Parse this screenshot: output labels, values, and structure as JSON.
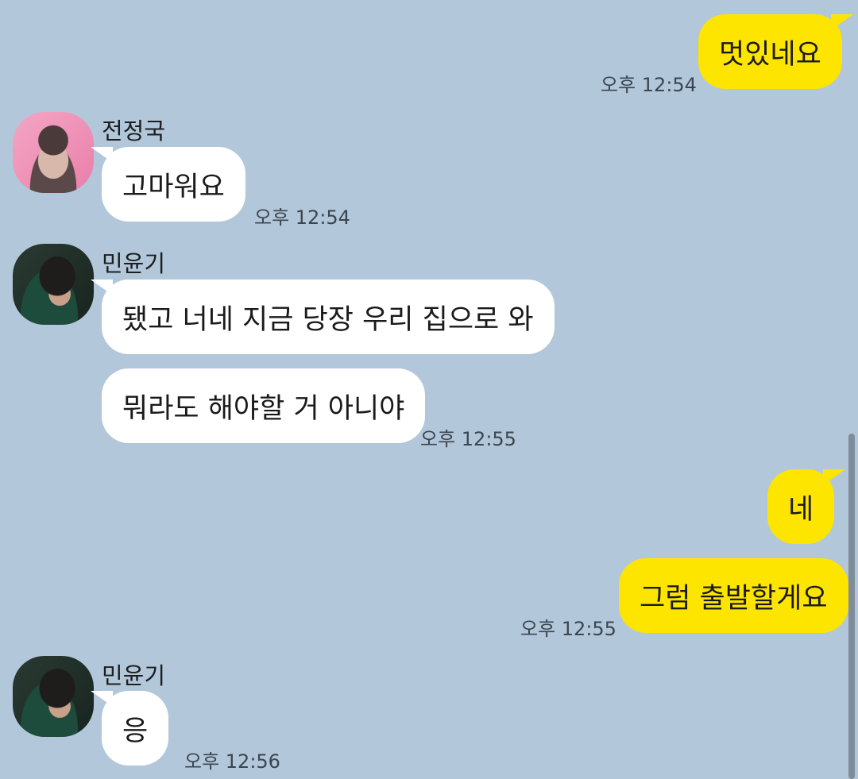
{
  "messages": {
    "m1": {
      "text": "멋있네요",
      "time": "오후 12:54"
    },
    "m2": {
      "sender": "전정국",
      "text": "고마워요",
      "time": "오후 12:54"
    },
    "m3": {
      "sender": "민윤기",
      "text1": "됐고 너네 지금 당장 우리 집으로 와",
      "text2": "뭐라도 해야할 거 아니야",
      "time": "오후 12:55"
    },
    "m4": {
      "text1": "네",
      "text2": "그럼 출발할게요",
      "time": "오후 12:55"
    },
    "m5": {
      "sender": "민윤기",
      "text": "응",
      "time": "오후 12:56"
    }
  },
  "colors": {
    "background": "#b2c7da",
    "my_bubble": "#fee500",
    "their_bubble": "#ffffff"
  },
  "icons": {
    "avatar_jungkook": "profile-photo-pink",
    "avatar_yoongi": "profile-photo-dark"
  }
}
